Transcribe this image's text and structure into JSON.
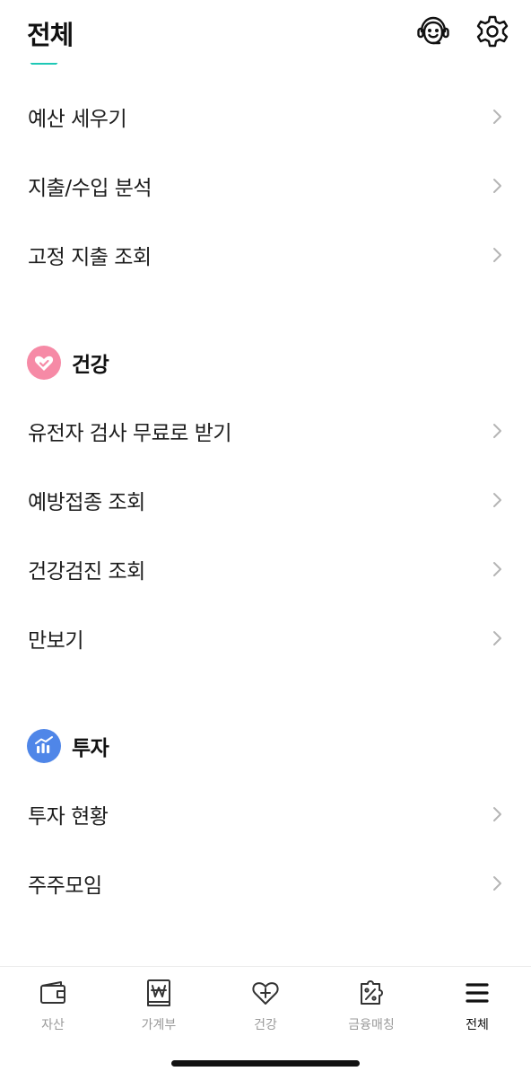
{
  "header": {
    "title": "전체",
    "support_icon": "headset-smile-icon",
    "settings_icon": "gear-icon"
  },
  "sections": {
    "budget": {
      "items": [
        {
          "label": "예산 세우기"
        },
        {
          "label": "지출/수입 분석"
        },
        {
          "label": "고정 지출 조회"
        }
      ]
    },
    "health": {
      "title": "건강",
      "icon": "heart-check-icon",
      "icon_color": "#f68aa6",
      "items": [
        {
          "label": "유전자 검사 무료로 받기"
        },
        {
          "label": "예방접종 조회"
        },
        {
          "label": "건강검진 조회"
        },
        {
          "label": "만보기"
        }
      ]
    },
    "invest": {
      "title": "투자",
      "icon": "chart-bars-icon",
      "icon_color": "#4f86e8",
      "items": [
        {
          "label": "투자 현황"
        },
        {
          "label": "주주모임"
        }
      ]
    }
  },
  "tabbar": {
    "tabs": [
      {
        "label": "자산",
        "icon": "wallet-icon",
        "active": false
      },
      {
        "label": "가계부",
        "icon": "won-book-icon",
        "active": false
      },
      {
        "label": "건강",
        "icon": "heart-plus-icon",
        "active": false
      },
      {
        "label": "금융매칭",
        "icon": "percent-puzzle-icon",
        "active": false
      },
      {
        "label": "전체",
        "icon": "menu-icon",
        "active": true
      }
    ]
  },
  "colors": {
    "accent_teal": "#1ec8b6",
    "chevron": "#b5b5b5",
    "inactive_tab": "#9a9a9a"
  }
}
